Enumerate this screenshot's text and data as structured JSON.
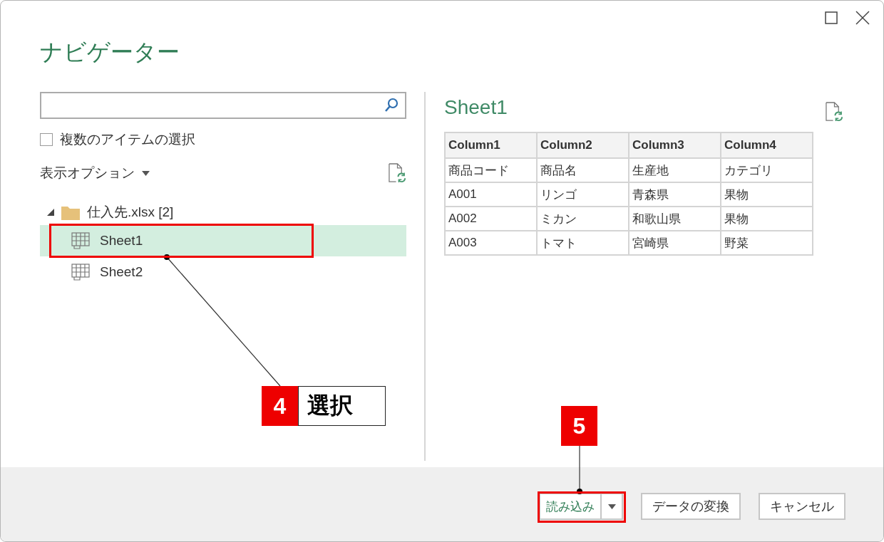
{
  "window": {
    "title": "ナビゲーター"
  },
  "multi_select": {
    "label": "複数のアイテムの選択",
    "checked": false
  },
  "display_options": {
    "label": "表示オプション"
  },
  "tree": [
    {
      "label": "仕入先.xlsx [2]",
      "expanded": true,
      "children": [
        {
          "label": "Sheet1",
          "selected": true
        },
        {
          "label": "Sheet2",
          "selected": false
        }
      ]
    }
  ],
  "preview": {
    "title": "Sheet1",
    "table": {
      "columns": [
        "Column1",
        "Column2",
        "Column3",
        "Column4"
      ],
      "rows": [
        [
          "商品コード",
          "商品名",
          "生産地",
          "カテゴリ"
        ],
        [
          "A001",
          "リンゴ",
          "青森県",
          "果物"
        ],
        [
          "A002",
          "ミカン",
          "和歌山県",
          "果物"
        ],
        [
          "A003",
          "トマト",
          "宮崎県",
          "野菜"
        ]
      ]
    }
  },
  "buttons": [
    {
      "label": "読み込み",
      "kind": "split"
    },
    {
      "label": "データの変換",
      "kind": "plain"
    },
    {
      "label": "キャンセル",
      "kind": "plain"
    }
  ],
  "annotations": [
    {
      "number": "4",
      "label": "選択",
      "kind": "item"
    },
    {
      "number": "5",
      "kind": "button"
    }
  ]
}
